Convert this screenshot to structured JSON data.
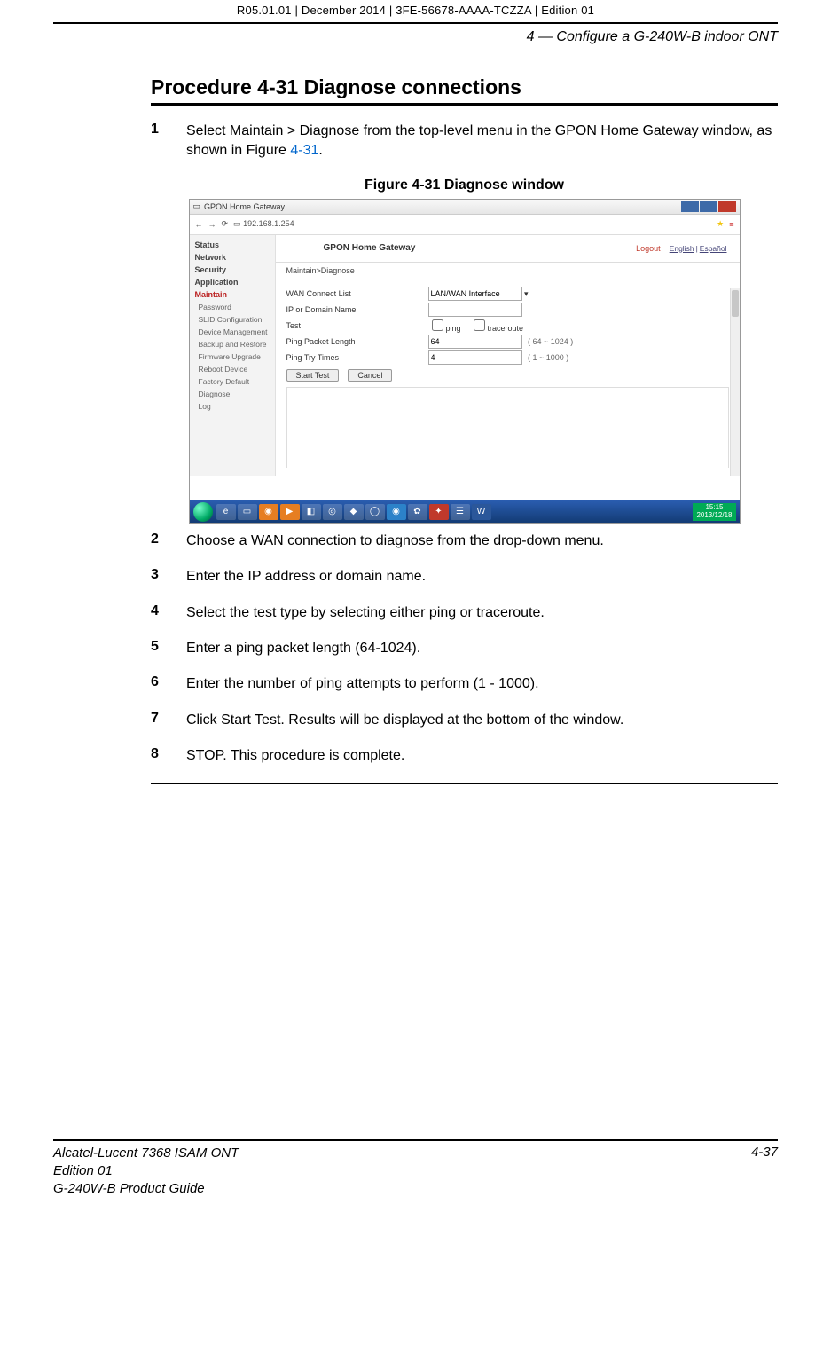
{
  "meta": {
    "top_line": "R05.01.01 | December 2014 | 3FE-56678-AAAA-TCZZA | Edition 01",
    "section_head": "4 —  Configure a G-240W-B indoor ONT"
  },
  "procedure": {
    "title": "Procedure 4-31  Diagnose connections"
  },
  "steps": {
    "s1": {
      "num": "1",
      "text_a": "Select Maintain > Diagnose from the top-level menu in the GPON Home Gateway window, as shown in Figure ",
      "link": "4-31",
      "text_b": "."
    },
    "s2": {
      "num": "2",
      "text": "Choose a WAN connection to diagnose from the drop-down menu."
    },
    "s3": {
      "num": "3",
      "text": "Enter the IP address or domain name."
    },
    "s4": {
      "num": "4",
      "text": "Select the test type by selecting either ping or traceroute."
    },
    "s5": {
      "num": "5",
      "text": "Enter a ping packet length (64-1024)."
    },
    "s6": {
      "num": "6",
      "text": "Enter the number of ping attempts to perform (1 - 1000)."
    },
    "s7": {
      "num": "7",
      "text": "Click Start Test. Results will be displayed at the bottom of the window."
    },
    "s8": {
      "num": "8",
      "text": "STOP. This procedure is complete."
    }
  },
  "figure": {
    "caption": "Figure 4-31  Diagnose window"
  },
  "screenshot": {
    "titlebar": "GPON Home Gateway",
    "address": "192.168.1.254",
    "banner": {
      "name": "GPON Home Gateway",
      "logout": "Logout",
      "lang1": "English",
      "lang2": "Español"
    },
    "breadcrumb": "Maintain>Diagnose",
    "sidebar": {
      "status": "Status",
      "network": "Network",
      "security": "Security",
      "application": "Application",
      "maintain": "Maintain",
      "sub": {
        "password": "Password",
        "slid": "SLID Configuration",
        "device": "Device Management",
        "backup": "Backup and Restore",
        "firmware": "Firmware Upgrade",
        "reboot": "Reboot Device",
        "factory": "Factory Default",
        "diagnose": "Diagnose",
        "log": "Log"
      }
    },
    "form": {
      "wan_label": "WAN Connect List",
      "wan_value": "LAN/WAN Interface",
      "ip_label": "IP or Domain Name",
      "test_label": "Test",
      "ping": "ping",
      "traceroute": "traceroute",
      "len_label": "Ping Packet Length",
      "len_value": "64",
      "len_range": "( 64 ~ 1024 )",
      "try_label": "Ping Try Times",
      "try_value": "4",
      "try_range": "( 1 ~ 1000 )",
      "start": "Start Test",
      "cancel": "Cancel"
    },
    "clock": {
      "time": "15:15",
      "date": "2013/12/18"
    }
  },
  "footer": {
    "l1": "Alcatel-Lucent 7368 ISAM ONT",
    "l2": "Edition 01",
    "l3": "G-240W-B Product Guide",
    "page": "4-37"
  }
}
